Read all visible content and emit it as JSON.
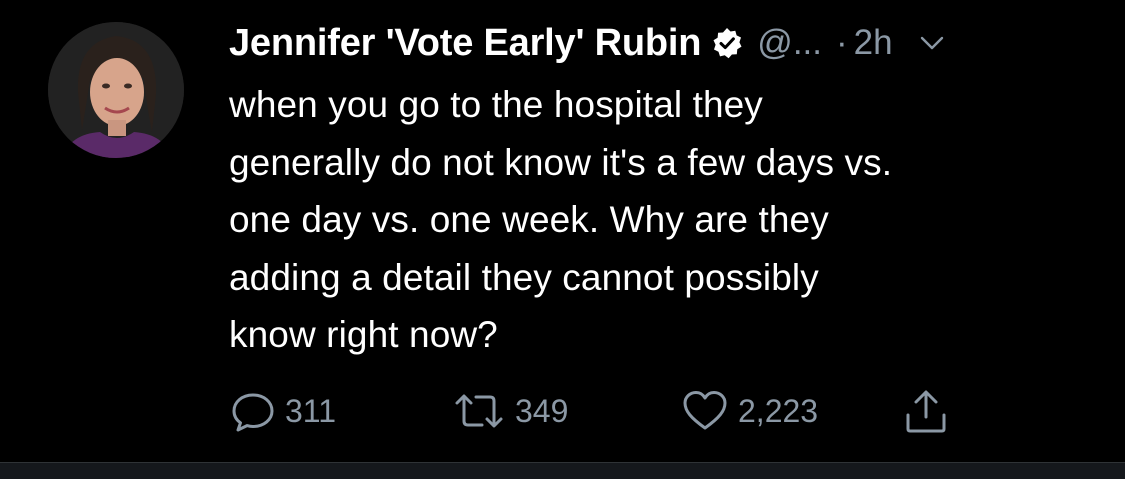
{
  "tweet": {
    "display_name": "Jennifer 'Vote Early' Rubin",
    "handle": "@...",
    "dot": "·",
    "time": "2h",
    "text_lines": [
      "when you go to the hospital they",
      "generally do not know it's a few days vs.",
      "one day vs. one week. Why are they",
      "adding a detail they cannot possibly",
      "know right now?"
    ],
    "reply_count": "311",
    "retweet_count": "349",
    "like_count": "2,223"
  },
  "icons": {
    "verified": "verified-badge-icon",
    "caret": "chevron-down-icon",
    "reply": "reply-icon",
    "retweet": "retweet-icon",
    "like": "heart-icon",
    "share": "share-icon"
  },
  "colors": {
    "background": "#000000",
    "text": "#ffffff",
    "secondary": "#8b98a5"
  }
}
